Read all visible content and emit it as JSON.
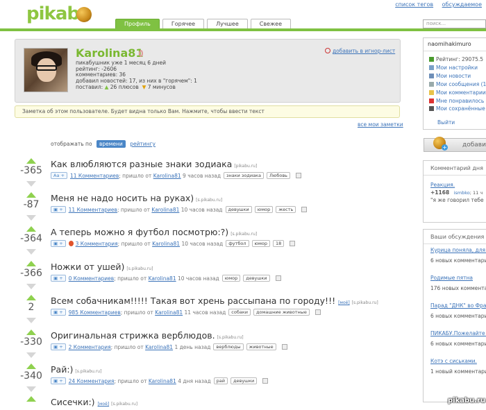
{
  "header": {
    "logo": "pikabu",
    "top_links": [
      "список тегов",
      "обсуждаемое"
    ],
    "tabs": [
      "Профиль",
      "Горячее",
      "Лучшее",
      "Свежее"
    ],
    "active_tab": "Профиль",
    "search_placeholder": "поиск..."
  },
  "profile": {
    "username": "Karolina81",
    "lines": [
      "пикабушник уже 1 месяц 6 дней",
      "рейтинг: -2606",
      "комментариев: 36",
      "добавил новостей: 17, из них в \"горячем\": 1"
    ],
    "voted_label": "поставил:",
    "pluses": "26 плюсов",
    "minuses": "7 минусов",
    "ignore_link": "добавить в игнор-лист"
  },
  "note": "Заметка об этом пользователе. Будет видна только Вам. Нажмите, чтобы ввести текст",
  "all_notes": "все мои заметки",
  "sort": {
    "label": "отображать по",
    "active": "времени",
    "other": "рейтингу"
  },
  "posts": [
    {
      "rating": "-365",
      "title": "Как влюбляются разные знаки зодиака",
      "mine": "",
      "source": "[pikabu.ru]",
      "share": "Aa +",
      "comments": "11 Комментариев",
      "from": "; пришло от",
      "author": "Karolina81",
      "time": "9 часов назад",
      "tags": [
        "знаки зодиака",
        "Любовь"
      ]
    },
    {
      "rating": "-87",
      "title": "Меня не надо носить на руках)",
      "mine": "",
      "source": "[s.pikabu.ru]",
      "share": "▣ +",
      "comments": "11 Комментариев",
      "from": "; пришло от",
      "author": "Karolina81",
      "time": "10 часов назад",
      "tags": [
        "девушки",
        "юмор",
        "жесть"
      ]
    },
    {
      "rating": "-364",
      "title": "А теперь можно я футбол посмотрю:?)",
      "mine": "",
      "source": "[s.pikabu.ru]",
      "share": "▣ +",
      "comments": "3 Комментария",
      "from": "; пришло от",
      "author": "Karolina81",
      "time": "10 часов назад",
      "tags": [
        "футбол",
        "юмор",
        "18"
      ]
    },
    {
      "rating": "-366",
      "title": "Ножки от ушей)",
      "mine": "",
      "source": "[s.pikabu.ru]",
      "share": "▣ +",
      "comments": "0 Комментариев",
      "from": "; пришло от",
      "author": "Karolina81",
      "time": "10 часов назад",
      "tags": [
        "юмор",
        "девушки"
      ]
    },
    {
      "rating": "2",
      "title": "Всем собачникам!!!!! Такая вот хрень рассыпана по городу!!!",
      "mine": "[моё]",
      "source": "[s.pikabu.ru]",
      "share": "▣ +",
      "comments": "985 Комментариев",
      "from": "; пришло от",
      "author": "Karolina81",
      "time": "11 часов назад",
      "tags": [
        "собаки",
        "домашние животные"
      ]
    },
    {
      "rating": "-330",
      "title": "Оригинальная стрижка верблюдов.",
      "mine": "",
      "source": "[s.pikabu.ru]",
      "share": "▣ +",
      "comments": "2 Комментария",
      "from": "; пришло от",
      "author": "Karolina81",
      "time": "1 день назад",
      "tags": [
        "верблюды",
        "животные"
      ]
    },
    {
      "rating": "-340",
      "title": "Рай:)",
      "mine": "",
      "source": "[s.pikabu.ru]",
      "share": "▣ +",
      "comments": "24 Комментария",
      "from": "; пришло от",
      "author": "Karolina81",
      "time": "4 дня назад",
      "tags": [
        "рай",
        "девушки"
      ]
    },
    {
      "rating": "",
      "title": "Сисечки:)",
      "mine": "[моё]",
      "source": "[s.pikabu.ru]",
      "share": "",
      "comments": "",
      "from": "",
      "author": "",
      "time": "",
      "tags": []
    }
  ],
  "sidebar": {
    "username": "naomihakimuro",
    "menu": [
      {
        "icon": "chart-icon",
        "label": "Рейтинг: 29075.5",
        "link": false
      },
      {
        "icon": "settings-icon",
        "label": "Мои настройки",
        "link": true
      },
      {
        "icon": "news-icon",
        "label": "Мои новости",
        "link": true
      },
      {
        "icon": "mail-icon",
        "label": "Мои сообщения (1",
        "link": true
      },
      {
        "icon": "comment-icon",
        "label": "Мои комментарии",
        "link": true
      },
      {
        "icon": "heart-icon",
        "label": "Мне понравилось",
        "link": true
      },
      {
        "icon": "saved-icon",
        "label": "Мои сохранённые",
        "link": true
      }
    ],
    "exit": "Выйти",
    "add_button": "добави",
    "comment_of_day": {
      "title": "Комментарий дня",
      "link": "Реакция.",
      "score": "+1168",
      "user": "ismbko",
      "time": "; 11 ч",
      "text": "\"я же говорил тебе"
    },
    "discussions": {
      "title": "Ваши обсуждения",
      "items": [
        {
          "link": "Курица поняла, для ч",
          "count": "6 новых комментари"
        },
        {
          "link": "Родимые пятна",
          "count": "176 новых комментари"
        },
        {
          "link": "Парад \"ДНК\" во Фран",
          "count": "6 новых комментари"
        },
        {
          "link": "ПИКАБУ.Пожелайте н",
          "count": "6 новых комментари"
        },
        {
          "link": "Котэ с сиськами.",
          "count": "1 новый комментари"
        }
      ]
    }
  },
  "watermark": "pikabu.ru",
  "colors": {
    "brand_green": "#7fc142",
    "link_blue": "#3b73b9",
    "note_bg": "#fdfce3"
  }
}
